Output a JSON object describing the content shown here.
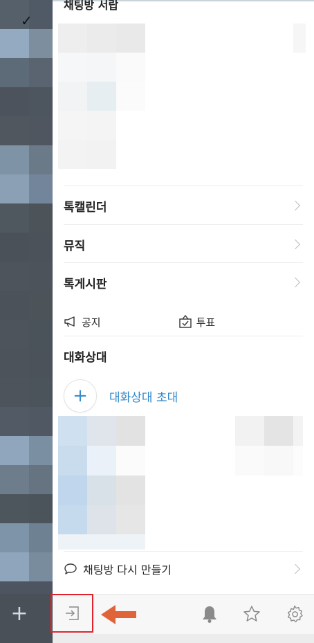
{
  "section_top": {
    "title": "채팅방 서랍"
  },
  "rows": [
    {
      "label": "톡캘린더"
    },
    {
      "label": "뮤직"
    },
    {
      "label": "톡게시판"
    }
  ],
  "quick_actions": {
    "notice": {
      "label": "공지",
      "icon": "megaphone-icon"
    },
    "vote": {
      "label": "투표",
      "icon": "ballot-icon"
    }
  },
  "members": {
    "heading": "대화상대",
    "invite_label": "대화상대 초대",
    "invite_icon": "plus-icon"
  },
  "recreate": {
    "label": "채팅방 다시 만들기",
    "icon": "speech-bubble-icon"
  },
  "bottom_bar": {
    "icons": [
      "exit-icon",
      "bell-icon",
      "star-icon",
      "gear-icon"
    ],
    "highlight_color": "#e0232a",
    "annotation_arrow_color": "#e0643a"
  },
  "colors": {
    "accent": "#2f86c7",
    "text": "#222222",
    "divider": "#ececec"
  }
}
